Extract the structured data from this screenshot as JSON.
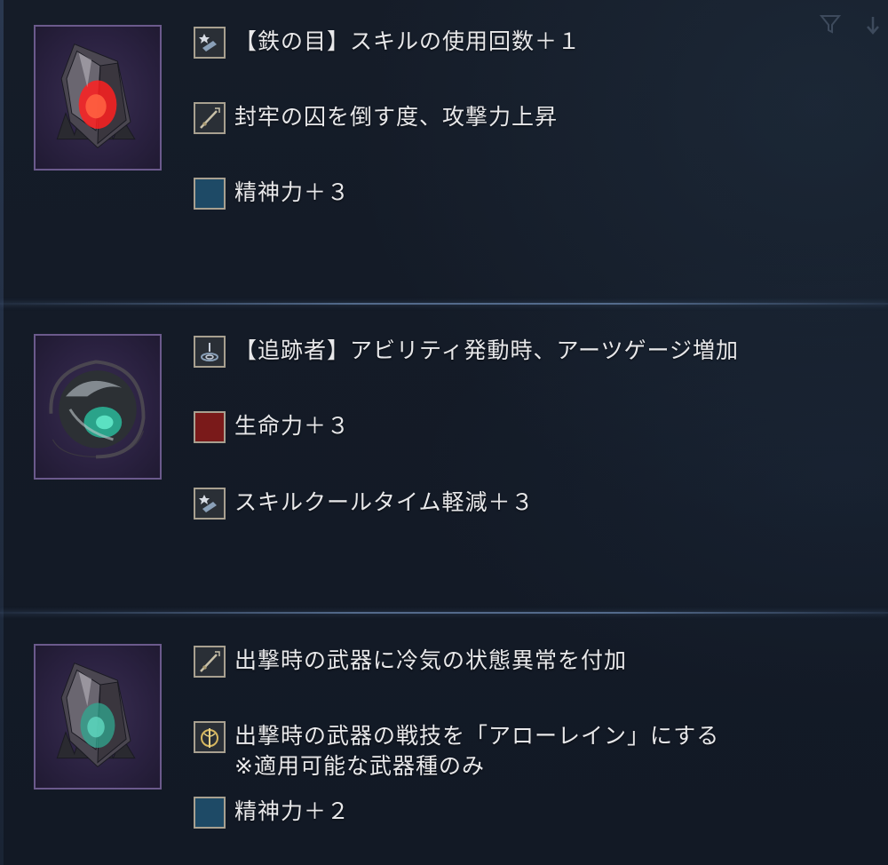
{
  "sections": [
    {
      "gem": "red-crystal-gem",
      "effects": [
        {
          "icon": "skill-hand-icon",
          "text": "【鉄の目】スキルの使用回数＋１"
        },
        {
          "icon": "sword-icon",
          "text": "封牢の囚を倒す度、攻撃力上昇"
        },
        {
          "icon": "spirit-blue-square-icon",
          "text": "精神力＋３"
        }
      ]
    },
    {
      "gem": "teal-orb-gem",
      "effects": [
        {
          "icon": "ability-swirl-icon",
          "text": "【追跡者】アビリティ発動時、アーツゲージ増加"
        },
        {
          "icon": "vitality-red-square-icon",
          "text": "生命力＋３"
        },
        {
          "icon": "skill-hand-icon",
          "text": "スキルクールタイム軽減＋３"
        }
      ]
    },
    {
      "gem": "teal-crystal-gem",
      "effects": [
        {
          "icon": "sword-icon",
          "text": "出撃時の武器に冷気の状態異常を付加"
        },
        {
          "icon": "weapon-art-emblem-icon",
          "text": "出撃時の武器の戦技を「アローレイン」にする",
          "subtext": "※適用可能な武器種のみ"
        },
        {
          "icon": "spirit-blue-square-icon",
          "text": "精神力＋２"
        }
      ]
    }
  ],
  "colors": {
    "background": "#131a26",
    "frame_border": "#6b5a8c",
    "text": "#e8e8ea",
    "vitality": "#7a1a1a",
    "spirit": "#1e4a66"
  }
}
